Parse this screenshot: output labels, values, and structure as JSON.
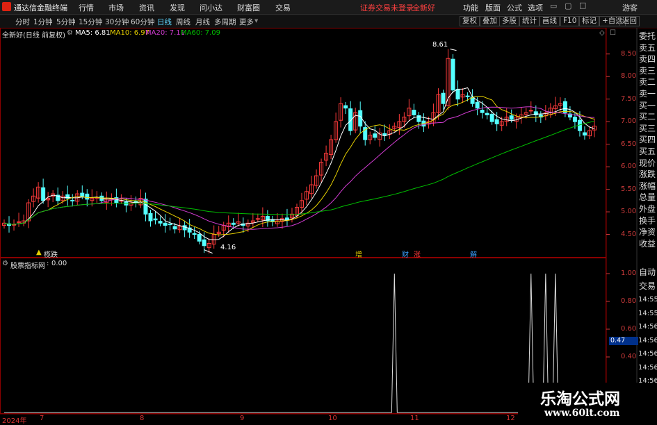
{
  "app": {
    "title": "通达信金融终端",
    "menu": [
      "行情",
      "市场",
      "资讯",
      "发现",
      "问小达",
      "财富圈",
      "交易"
    ],
    "notice": "证券交易未登录",
    "stock_name": "全新好",
    "right_menu": [
      "功能",
      "版面",
      "公式",
      "选项"
    ],
    "user": "游客"
  },
  "periods": [
    "分时",
    "1分钟",
    "5分钟",
    "15分钟",
    "30分钟",
    "60分钟",
    "日线",
    "周线",
    "月线",
    "多周期",
    "更多"
  ],
  "active_period": "日线",
  "tools": [
    "复权",
    "叠加",
    "多股",
    "统计",
    "画线",
    "F10",
    "标记",
    "+自选",
    "返回"
  ],
  "chart_header": {
    "title": "全新好(日线 前复权)",
    "ma5": "MA5: 6.81",
    "ma10": "MA10: 6.97",
    "ma20": "MA20: 7.11",
    "ma60": "MA60: 7.09"
  },
  "side_panel": [
    "委托",
    "卖五",
    "卖四",
    "卖三",
    "卖二",
    "卖一",
    "买一",
    "买二",
    "买三",
    "买四",
    "买五",
    "现价",
    "涨跌",
    "涨幅",
    "总量",
    "外盘",
    "换手",
    "净资",
    "收益"
  ],
  "side_panel_lower": [
    "自动",
    "交易",
    "14:55",
    "14:55",
    "14:56",
    "14:56",
    "14:56",
    "14:56",
    "14:56"
  ],
  "indicator": {
    "name": "股票指标网",
    "value": "0.00",
    "current_label": "0.47"
  },
  "price_labels": {
    "high": "8.61",
    "low": "4.16"
  },
  "events": [
    {
      "text": "榄跌",
      "color": "#e6d000"
    },
    {
      "text": "增",
      "color": "#e6d000"
    },
    {
      "text": "财",
      "color": "#3aa0ff"
    },
    {
      "text": "涨",
      "color": "#ff3b3b"
    },
    {
      "text": "解",
      "color": "#3aa0ff"
    }
  ],
  "x_labels": [
    "2024年",
    "7",
    "8",
    "9",
    "10",
    "11",
    "12"
  ],
  "watermark": {
    "name": "乐淘公式网",
    "url": "www.60lt.com"
  },
  "colors": {
    "up": "#ff3b3b",
    "down": "#54ffff",
    "ma5": "#ffffff",
    "ma10": "#e6d000",
    "ma20": "#d23cd2",
    "ma60": "#00c000",
    "axis": "#8b0000"
  },
  "chart_data": [
    {
      "type": "candlestick",
      "title": "全新好(日线 前复权)",
      "y_ticks": [
        4.5,
        5.0,
        5.5,
        6.0,
        6.5,
        7.0,
        7.5,
        8.0,
        8.5
      ],
      "ylim": [
        4.0,
        8.85
      ],
      "x_ticks": [
        "2024年",
        "7",
        "8",
        "9",
        "10",
        "11",
        "12"
      ],
      "series_close": [
        4.75,
        4.7,
        4.72,
        4.78,
        4.8,
        5.2,
        5.35,
        5.55,
        5.25,
        5.3,
        5.4,
        5.25,
        5.35,
        5.3,
        5.25,
        5.4,
        5.35,
        5.28,
        5.3,
        5.32,
        5.25,
        5.28,
        5.3,
        5.2,
        5.25,
        5.15,
        5.2,
        5.2,
        5.3,
        4.95,
        4.8,
        4.82,
        4.75,
        4.7,
        4.72,
        4.62,
        4.68,
        4.6,
        4.55,
        4.5,
        4.35,
        4.25,
        4.3,
        4.5,
        4.55,
        4.7,
        4.75,
        4.72,
        4.78,
        4.7,
        4.75,
        4.8,
        4.85,
        4.9,
        4.8,
        4.78,
        4.8,
        4.85,
        4.82,
        4.95,
        5.1,
        5.25,
        5.45,
        5.6,
        5.8,
        6.1,
        6.3,
        6.6,
        7.0,
        7.4,
        7.3,
        6.8,
        7.2,
        6.9,
        6.6,
        6.7,
        6.65,
        6.75,
        6.7,
        6.8,
        6.9,
        7.0,
        7.1,
        7.3,
        7.15,
        7.0,
        6.9,
        7.0,
        7.2,
        7.6,
        7.4,
        8.4,
        7.7,
        7.5,
        7.6,
        7.55,
        7.4,
        7.3,
        7.2,
        7.15,
        7.0,
        6.95,
        7.0,
        7.1,
        7.05,
        7.1,
        7.15,
        7.2,
        7.25,
        7.15,
        7.1,
        7.2,
        7.3,
        7.35,
        7.4,
        7.2,
        7.1,
        7.0,
        6.8,
        6.7,
        6.8,
        6.9
      ],
      "series": [
        {
          "name": "MA5",
          "last": 6.81
        },
        {
          "name": "MA10",
          "last": 6.97
        },
        {
          "name": "MA20",
          "last": 7.11
        },
        {
          "name": "MA60",
          "last": 7.09
        }
      ],
      "annotations": [
        {
          "text": "8.61",
          "value": 8.61
        },
        {
          "text": "4.16",
          "value": 4.16
        }
      ]
    },
    {
      "type": "line",
      "title": "股票指标网",
      "y_ticks": [
        0.4,
        0.6,
        0.8,
        1.0
      ],
      "ylim": [
        0,
        1.05
      ],
      "spikes_at_index": [
        80,
        108,
        111,
        113
      ],
      "value": 0.0
    }
  ]
}
